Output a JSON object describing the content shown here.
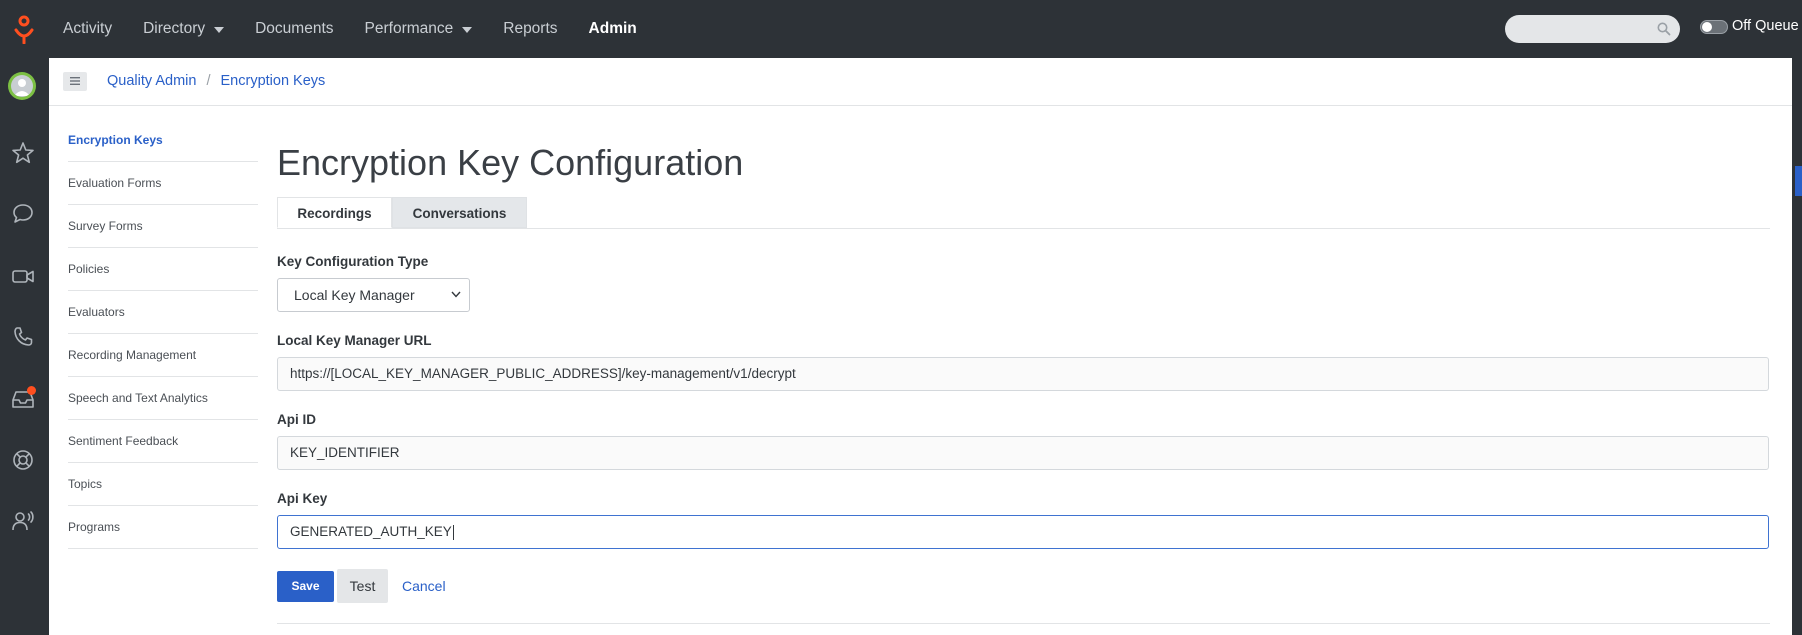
{
  "nav": {
    "items": [
      {
        "label": "Activity",
        "dropdown": false,
        "active": false
      },
      {
        "label": "Directory",
        "dropdown": true,
        "active": false
      },
      {
        "label": "Documents",
        "dropdown": false,
        "active": false
      },
      {
        "label": "Performance",
        "dropdown": true,
        "active": false
      },
      {
        "label": "Reports",
        "dropdown": false,
        "active": false
      },
      {
        "label": "Admin",
        "dropdown": false,
        "active": true
      }
    ],
    "search_icon": "search-icon",
    "queue_toggle_label": "Off Queue",
    "queue_toggle_on": false
  },
  "rail": {
    "icons": [
      "avatar",
      "star-icon",
      "chat-icon",
      "video-icon",
      "phone-icon",
      "inbox-icon",
      "lifebuoy-icon",
      "user-broadcast-icon"
    ],
    "notification_color": "#ff4f1f"
  },
  "breadcrumb": {
    "items": [
      "Quality Admin",
      "Encryption Keys"
    ],
    "separator": "/"
  },
  "subnav": {
    "items": [
      {
        "label": "Encryption Keys",
        "active": true
      },
      {
        "label": "Evaluation Forms",
        "active": false
      },
      {
        "label": "Survey Forms",
        "active": false
      },
      {
        "label": "Policies",
        "active": false
      },
      {
        "label": "Evaluators",
        "active": false
      },
      {
        "label": "Recording Management",
        "active": false
      },
      {
        "label": "Speech and Text Analytics",
        "active": false
      },
      {
        "label": "Sentiment Feedback",
        "active": false
      },
      {
        "label": "Topics",
        "active": false
      },
      {
        "label": "Programs",
        "active": false
      }
    ]
  },
  "main": {
    "title": "Encryption Key Configuration",
    "tabs": [
      {
        "label": "Recordings",
        "active": true
      },
      {
        "label": "Conversations",
        "active": false
      }
    ],
    "form": {
      "key_type_label": "Key Configuration Type",
      "key_type_value": "Local Key Manager",
      "url_label": "Local Key Manager URL",
      "url_value": "https://[LOCAL_KEY_MANAGER_PUBLIC_ADDRESS]/key-management/v1/decrypt",
      "api_id_label": "Api ID",
      "api_id_value": "KEY_IDENTIFIER",
      "api_key_label": "Api Key",
      "api_key_value": "GENERATED_AUTH_KEY"
    },
    "actions": {
      "save": "Save",
      "test": "Test",
      "cancel": "Cancel"
    }
  },
  "colors": {
    "accent": "#2a60c8",
    "topbar": "#2d3237",
    "brand": "#ff4f1f",
    "presence": "#7cc043"
  }
}
